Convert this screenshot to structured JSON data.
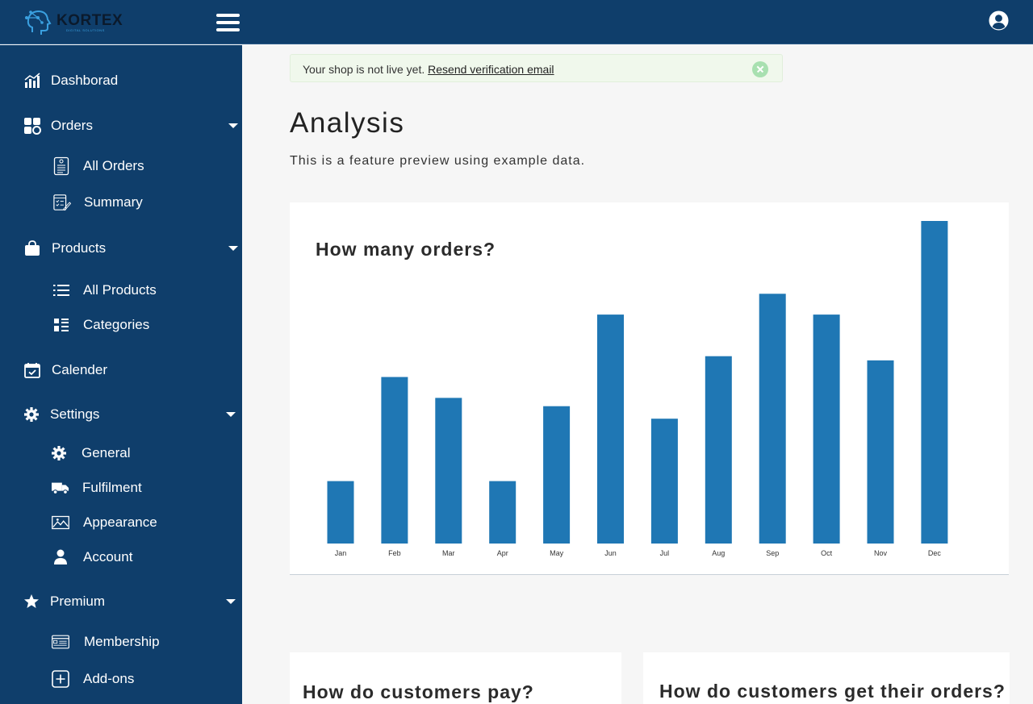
{
  "brand": {
    "name": "KORTEX",
    "tagline": "DIGITAL SOLUTIONS"
  },
  "colors": {
    "nav_bg": "#0f3e6b",
    "bar": "#1f77b4",
    "alert_bg": "#f0f8ec"
  },
  "sidebar": {
    "items": [
      {
        "label": "Dashborad",
        "icon": "bar-chart-icon"
      },
      {
        "label": "Orders",
        "icon": "orders-icon",
        "expandable": true
      },
      {
        "label": "All Orders",
        "icon": "receipt-icon"
      },
      {
        "label": "Summary",
        "icon": "checklist-icon"
      },
      {
        "label": "Products",
        "icon": "bag-icon",
        "expandable": true
      },
      {
        "label": "All Products",
        "icon": "list-icon"
      },
      {
        "label": "Categories",
        "icon": "grid-list-icon"
      },
      {
        "label": "Calender",
        "icon": "calendar-icon"
      },
      {
        "label": "Settings",
        "icon": "gear-icon",
        "expandable": true
      },
      {
        "label": "General",
        "icon": "gear-icon"
      },
      {
        "label": "Fulfilment",
        "icon": "truck-icon"
      },
      {
        "label": "Appearance",
        "icon": "image-icon"
      },
      {
        "label": "Account",
        "icon": "user-icon"
      },
      {
        "label": "Premium",
        "icon": "star-icon",
        "expandable": true
      },
      {
        "label": "Membership",
        "icon": "credit-card-icon"
      },
      {
        "label": "Add-ons",
        "icon": "plus-square-icon"
      }
    ]
  },
  "alert": {
    "text": "Your shop is not live yet. ",
    "link": "Resend verification email"
  },
  "page": {
    "title": "Analysis",
    "subtitle": "This is a feature preview using example data."
  },
  "chart_data": {
    "type": "bar",
    "title": "How many orders?",
    "categories": [
      "Jan",
      "Feb",
      "Mar",
      "Apr",
      "May",
      "Jun",
      "Jul",
      "Aug",
      "Sep",
      "Oct",
      "Nov",
      "Dec"
    ],
    "values": [
      30,
      80,
      70,
      30,
      66,
      110,
      60,
      90,
      120,
      110,
      88,
      155
    ],
    "ylim": [
      0,
      155
    ],
    "grid": false,
    "legend": false
  },
  "cards": {
    "payment_title": "How do customers pay?",
    "delivery_title": "How do customers get their orders?"
  }
}
